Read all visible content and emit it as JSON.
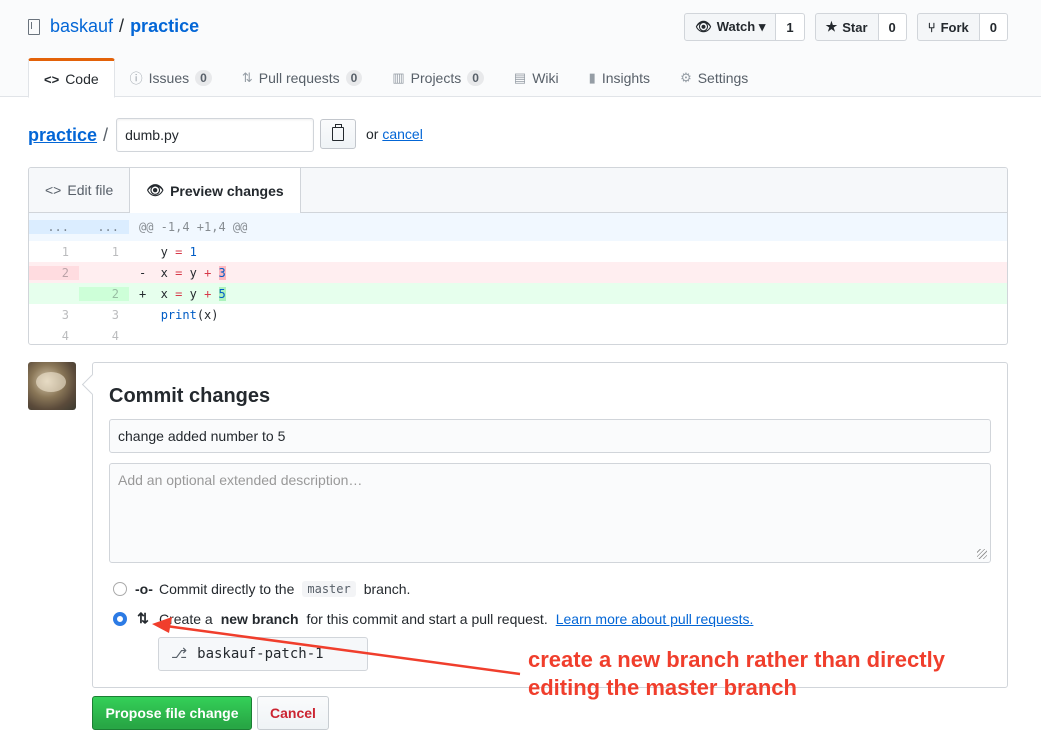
{
  "repo": {
    "owner": "baskauf",
    "separator": "/",
    "name": "practice"
  },
  "actions": [
    {
      "label": "Watch ▾",
      "icon": "eye-icon",
      "count": "1"
    },
    {
      "label": "Star",
      "icon": "star-icon",
      "count": "0"
    },
    {
      "label": "Fork",
      "icon": "fork-icon",
      "count": "0"
    }
  ],
  "tabs": [
    {
      "label": "Code",
      "icon": "code-icon",
      "count": null,
      "selected": true
    },
    {
      "label": "Issues",
      "icon": "issue-icon",
      "count": "0"
    },
    {
      "label": "Pull requests",
      "icon": "pull-request-icon",
      "count": "0"
    },
    {
      "label": "Projects",
      "icon": "project-icon",
      "count": "0"
    },
    {
      "label": "Wiki",
      "icon": "book-icon",
      "count": null
    },
    {
      "label": "Insights",
      "icon": "graph-icon",
      "count": null
    },
    {
      "label": "Settings",
      "icon": "gear-icon",
      "count": null
    }
  ],
  "breadcrumb": {
    "root": "practice",
    "sep": "/",
    "filename": "dumb.py",
    "or": "or",
    "cancel": "cancel"
  },
  "editor": {
    "edit_tab": "Edit file",
    "preview_tab": "Preview changes",
    "hunk": {
      "left": "...",
      "right": "...",
      "text": "@@ -1,4 +1,4 @@"
    },
    "lines": [
      {
        "type": "ctx",
        "old": "1",
        "new": "1",
        "marker": " ",
        "code": "y = 1"
      },
      {
        "type": "del",
        "old": "2",
        "new": "",
        "marker": "-",
        "code": "x = y + 3"
      },
      {
        "type": "add",
        "old": "",
        "new": "2",
        "marker": "+",
        "code": "x = y + 5"
      },
      {
        "type": "ctx",
        "old": "3",
        "new": "3",
        "marker": " ",
        "code": "print(x)"
      },
      {
        "type": "ctx",
        "old": "4",
        "new": "4",
        "marker": " ",
        "code": ""
      }
    ]
  },
  "commit": {
    "title": "Commit changes",
    "summary": "change added number to 5",
    "description_placeholder": "Add an optional extended description…",
    "option_direct": {
      "pre": "Commit directly to the",
      "branch": "master",
      "post": "branch."
    },
    "option_new": {
      "pre": "Create a",
      "bold": "new branch",
      "post": "for this commit and start a pull request.",
      "link": "Learn more about pull requests."
    },
    "branch_name": "baskauf-patch-1"
  },
  "buttons": {
    "propose": "Propose file change",
    "cancel": "Cancel"
  },
  "annotation": {
    "line1": "create a new branch rather than directly",
    "line2": "editing the master branch"
  },
  "colors": {
    "accent": "#0366d6",
    "annotation": "#f03e2c",
    "propose": "#28a745",
    "tab_accent": "#e36209"
  }
}
